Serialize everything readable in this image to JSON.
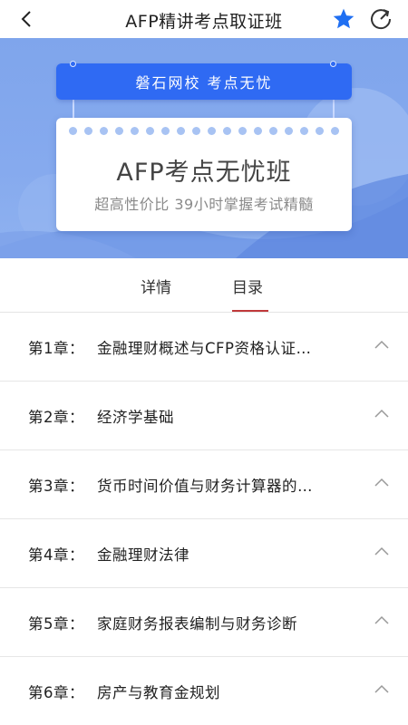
{
  "header": {
    "title": "AFP精讲考点取证班",
    "back_icon": "chevron-left-icon",
    "favorite_icon": "star-icon",
    "share_icon": "share-icon",
    "favorite_color": "#1f6ff2"
  },
  "banner": {
    "tag_text": "磐石网校  考点无忧",
    "card_title": "AFP考点无忧班",
    "card_subtitle": "超高性价比  39小时掌握考试精髓",
    "tag_color": "#2f6af3",
    "background_color": "#86aaee"
  },
  "tabs": [
    {
      "label": "详情",
      "active": false
    },
    {
      "label": "目录",
      "active": true
    }
  ],
  "tab_accent": "#c0393b",
  "chapters": [
    {
      "number": "第1章：",
      "title": "金融理财概述与CFP资格认证…"
    },
    {
      "number": "第2章：",
      "title": "经济学基础"
    },
    {
      "number": "第3章：",
      "title": "货币时间价值与财务计算器的…"
    },
    {
      "number": "第4章：",
      "title": "金融理财法律"
    },
    {
      "number": "第5章：",
      "title": "家庭财务报表编制与财务诊断"
    },
    {
      "number": "第6章：",
      "title": "房产与教育金规划"
    }
  ]
}
